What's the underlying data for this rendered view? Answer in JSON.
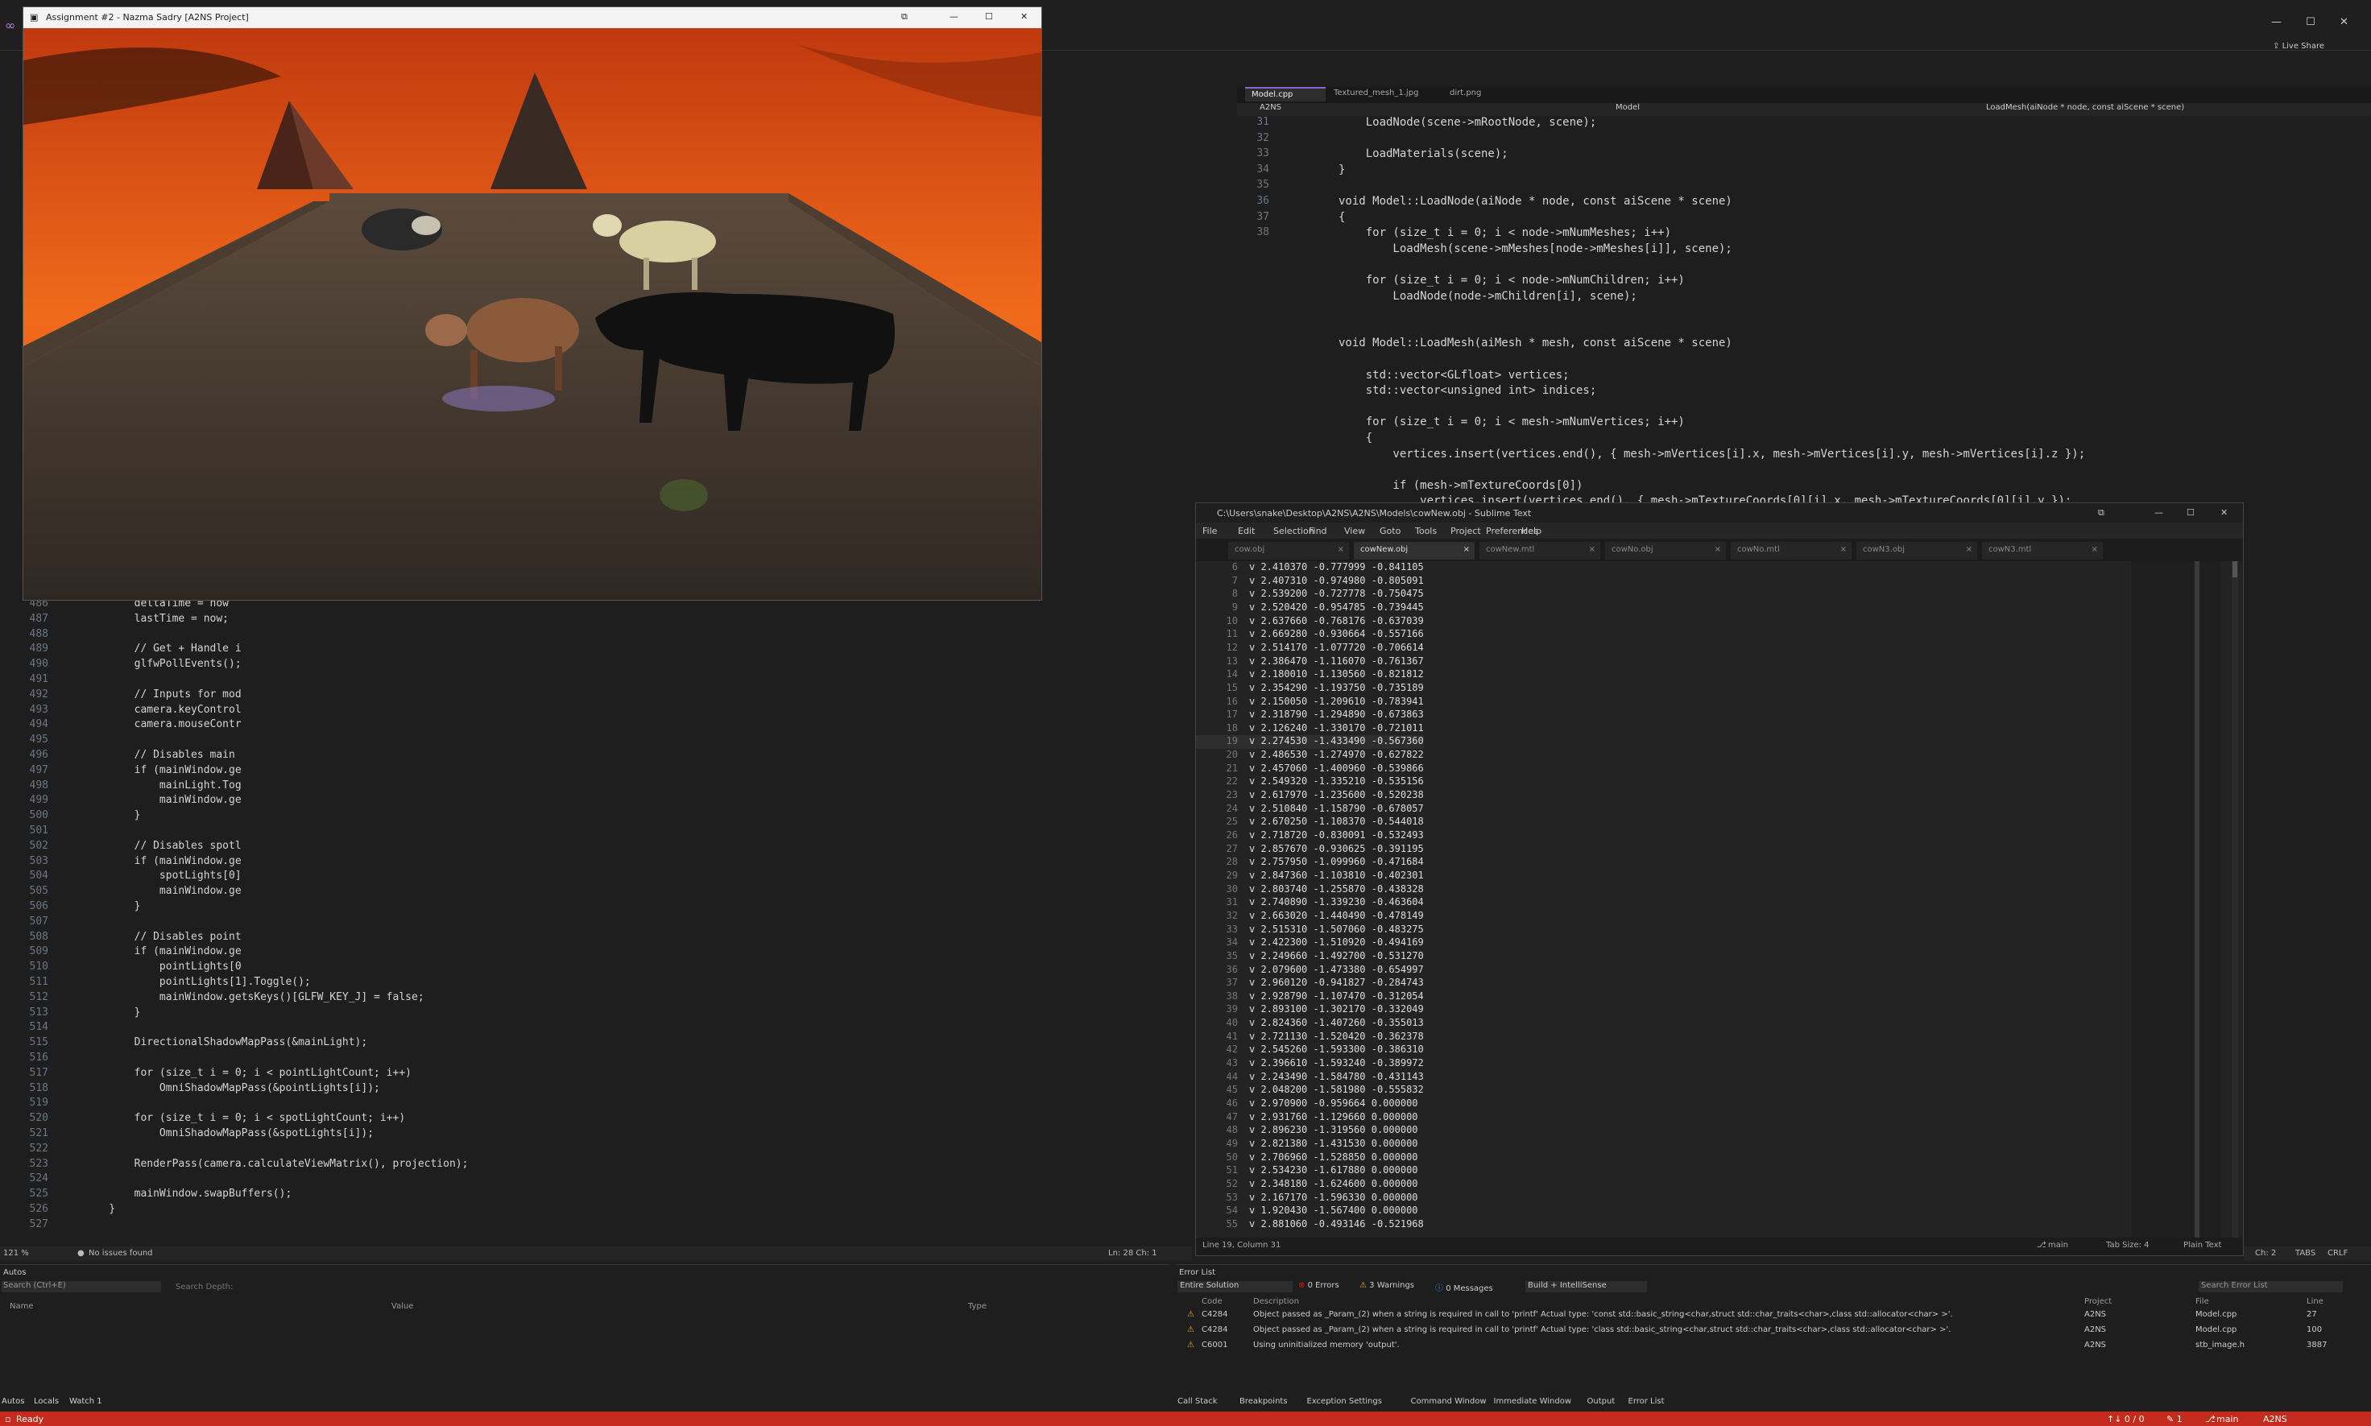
{
  "vs": {
    "live_share": "Live Share",
    "editor_tabs": [
      "Model.cpp",
      "Textured_mesh_1.jpg",
      "dirt.png"
    ],
    "nav_scope": "A2NS",
    "nav_class": "Model",
    "nav_method": "LoadMesh(aiNode * node, const aiScene * scene)",
    "code_lines": [
      {
        "n": "31",
        "t": "    LoadNode(scene->mRootNode, scene);"
      },
      {
        "n": "32",
        "t": ""
      },
      {
        "n": "33",
        "t": "    LoadMaterials(scene);"
      },
      {
        "n": "34",
        "t": "}"
      },
      {
        "n": "35",
        "t": ""
      },
      {
        "n": "36",
        "t": "void Model::LoadNode(aiNode * node, const aiScene * scene)"
      },
      {
        "n": "37",
        "t": "{"
      },
      {
        "n": "38",
        "t": "    for (size_t i = 0; i < node->mNumMeshes; i++)"
      },
      {
        "n": "",
        "t": "        LoadMesh(scene->mMeshes[node->mMeshes[i]], scene);"
      },
      {
        "n": "",
        "t": ""
      },
      {
        "n": "",
        "t": "    for (size_t i = 0; i < node->mNumChildren; i++)"
      },
      {
        "n": "",
        "t": "        LoadNode(node->mChildren[i], scene);"
      },
      {
        "n": "",
        "t": ""
      },
      {
        "n": "",
        "t": ""
      },
      {
        "n": "",
        "t": "void Model::LoadMesh(aiMesh * mesh, const aiScene * scene)"
      },
      {
        "n": "",
        "t": ""
      },
      {
        "n": "",
        "t": "    std::vector<GLfloat> vertices;"
      },
      {
        "n": "",
        "t": "    std::vector<unsigned int> indices;"
      },
      {
        "n": "",
        "t": ""
      },
      {
        "n": "",
        "t": "    for (size_t i = 0; i < mesh->mNumVertices; i++)"
      },
      {
        "n": "",
        "t": "    {"
      },
      {
        "n": "",
        "t": "        vertices.insert(vertices.end(), { mesh->mVertices[i].x, mesh->mVertices[i].y, mesh->mVertices[i].z });"
      },
      {
        "n": "",
        "t": ""
      },
      {
        "n": "",
        "t": "        if (mesh->mTextureCoords[0])"
      },
      {
        "n": "",
        "t": "            vertices.insert(vertices.end(), { mesh->mTextureCoords[0][i].x, mesh->mTextureCoords[0][i].y });"
      }
    ],
    "left_code": [
      {
        "n": "486",
        "t": "        deltaTime = now"
      },
      {
        "n": "487",
        "t": "        lastTime = now;"
      },
      {
        "n": "488",
        "t": ""
      },
      {
        "n": "489",
        "t": "        // Get + Handle i"
      },
      {
        "n": "490",
        "t": "        glfwPollEvents();"
      },
      {
        "n": "491",
        "t": ""
      },
      {
        "n": "492",
        "t": "        // Inputs for mod"
      },
      {
        "n": "493",
        "t": "        camera.keyControl"
      },
      {
        "n": "494",
        "t": "        camera.mouseContr"
      },
      {
        "n": "495",
        "t": ""
      },
      {
        "n": "496",
        "t": "        // Disables main"
      },
      {
        "n": "497",
        "t": "        if (mainWindow.ge"
      },
      {
        "n": "498",
        "t": "            mainLight.Tog"
      },
      {
        "n": "499",
        "t": "            mainWindow.ge"
      },
      {
        "n": "500",
        "t": "        }"
      },
      {
        "n": "501",
        "t": ""
      },
      {
        "n": "502",
        "t": "        // Disables spotl"
      },
      {
        "n": "503",
        "t": "        if (mainWindow.ge"
      },
      {
        "n": "504",
        "t": "            spotLights[0]"
      },
      {
        "n": "505",
        "t": "            mainWindow.ge"
      },
      {
        "n": "506",
        "t": "        }"
      },
      {
        "n": "507",
        "t": ""
      },
      {
        "n": "508",
        "t": "        // Disables point"
      },
      {
        "n": "509",
        "t": "        if (mainWindow.ge"
      },
      {
        "n": "510",
        "t": "            pointLights[0"
      },
      {
        "n": "511",
        "t": "            pointLights[1].Toggle();"
      },
      {
        "n": "512",
        "t": "            mainWindow.getsKeys()[GLFW_KEY_J] = false;"
      },
      {
        "n": "513",
        "t": "        }"
      },
      {
        "n": "514",
        "t": ""
      },
      {
        "n": "515",
        "t": "        DirectionalShadowMapPass(&mainLight);"
      },
      {
        "n": "516",
        "t": ""
      },
      {
        "n": "517",
        "t": "        for (size_t i = 0; i < pointLightCount; i++)"
      },
      {
        "n": "518",
        "t": "            OmniShadowMapPass(&pointLights[i]);"
      },
      {
        "n": "519",
        "t": ""
      },
      {
        "n": "520",
        "t": "        for (size_t i = 0; i < spotLightCount; i++)"
      },
      {
        "n": "521",
        "t": "            OmniShadowMapPass(&spotLights[i]);"
      },
      {
        "n": "522",
        "t": ""
      },
      {
        "n": "523",
        "t": "        RenderPass(camera.calculateViewMatrix(), projection);"
      },
      {
        "n": "524",
        "t": ""
      },
      {
        "n": "525",
        "t": "        mainWindow.swapBuffers();"
      },
      {
        "n": "526",
        "t": "    }"
      },
      {
        "n": "527",
        "t": ""
      }
    ],
    "left_status": {
      "zoom": "121 %",
      "issues": "No issues found",
      "pos": "Ln: 28   Ch: 1"
    },
    "right_status": {
      "pos": "Ch: 2",
      "tabs": "TABS",
      "crlf": "CRLF"
    }
  },
  "game": {
    "title": "Assignment #2 - Nazma Sadry [A2NS Project]"
  },
  "sublime": {
    "title": "C:\\Users\\snake\\Desktop\\A2NS\\A2NS\\Models\\cowNew.obj - Sublime Text",
    "menu": [
      "File",
      "Edit",
      "Selection",
      "Find",
      "View",
      "Goto",
      "Tools",
      "Project",
      "Preferences",
      "Help"
    ],
    "tabs": [
      "cow.obj",
      "cowNew.obj",
      "cowNew.mtl",
      "cowNo.obj",
      "cowNo.mtl",
      "cowN3.obj",
      "cowN3.mtl"
    ],
    "active_tab": 1,
    "lines": [
      {
        "n": "6",
        "t": "v 2.410370 -0.777999 -0.841105"
      },
      {
        "n": "7",
        "t": "v 2.407310 -0.974980 -0.805091"
      },
      {
        "n": "8",
        "t": "v 2.539200 -0.727778 -0.750475"
      },
      {
        "n": "9",
        "t": "v 2.520420 -0.954785 -0.739445"
      },
      {
        "n": "10",
        "t": "v 2.637660 -0.768176 -0.637039"
      },
      {
        "n": "11",
        "t": "v 2.669280 -0.930664 -0.557166"
      },
      {
        "n": "12",
        "t": "v 2.514170 -1.077720 -0.706614"
      },
      {
        "n": "13",
        "t": "v 2.386470 -1.116070 -0.761367"
      },
      {
        "n": "14",
        "t": "v 2.180010 -1.130560 -0.821812"
      },
      {
        "n": "15",
        "t": "v 2.354290 -1.193750 -0.735189"
      },
      {
        "n": "16",
        "t": "v 2.150050 -1.209610 -0.783941"
      },
      {
        "n": "17",
        "t": "v 2.318790 -1.294890 -0.673863"
      },
      {
        "n": "18",
        "t": "v 2.126240 -1.330170 -0.721011"
      },
      {
        "n": "19",
        "t": "v 2.274530 -1.433490 -0.567360"
      },
      {
        "n": "20",
        "t": "v 2.486530 -1.274970 -0.627822"
      },
      {
        "n": "21",
        "t": "v 2.457060 -1.400960 -0.539866"
      },
      {
        "n": "22",
        "t": "v 2.549320 -1.335210 -0.535156"
      },
      {
        "n": "23",
        "t": "v 2.617970 -1.235600 -0.520238"
      },
      {
        "n": "24",
        "t": "v 2.510840 -1.158790 -0.678057"
      },
      {
        "n": "25",
        "t": "v 2.670250 -1.108370 -0.544018"
      },
      {
        "n": "26",
        "t": "v 2.718720 -0.830091 -0.532493"
      },
      {
        "n": "27",
        "t": "v 2.857670 -0.930625 -0.391195"
      },
      {
        "n": "28",
        "t": "v 2.757950 -1.099960 -0.471684"
      },
      {
        "n": "29",
        "t": "v 2.847360 -1.103810 -0.402301"
      },
      {
        "n": "30",
        "t": "v 2.803740 -1.255870 -0.438328"
      },
      {
        "n": "31",
        "t": "v 2.740890 -1.339230 -0.463604"
      },
      {
        "n": "32",
        "t": "v 2.663020 -1.440490 -0.478149"
      },
      {
        "n": "33",
        "t": "v 2.515310 -1.507060 -0.483275"
      },
      {
        "n": "34",
        "t": "v 2.422300 -1.510920 -0.494169"
      },
      {
        "n": "35",
        "t": "v 2.249660 -1.492700 -0.531270"
      },
      {
        "n": "36",
        "t": "v 2.079600 -1.473380 -0.654997"
      },
      {
        "n": "37",
        "t": "v 2.960120 -0.941827 -0.284743"
      },
      {
        "n": "38",
        "t": "v 2.928790 -1.107470 -0.312054"
      },
      {
        "n": "39",
        "t": "v 2.893100 -1.302170 -0.332049"
      },
      {
        "n": "40",
        "t": "v 2.824360 -1.407260 -0.355013"
      },
      {
        "n": "41",
        "t": "v 2.721130 -1.520420 -0.362378"
      },
      {
        "n": "42",
        "t": "v 2.545260 -1.593300 -0.386310"
      },
      {
        "n": "43",
        "t": "v 2.396610 -1.593240 -0.389972"
      },
      {
        "n": "44",
        "t": "v 2.243490 -1.584780 -0.431143"
      },
      {
        "n": "45",
        "t": "v 2.048200 -1.581980 -0.555832"
      },
      {
        "n": "46",
        "t": "v 2.970900 -0.959664 0.000000"
      },
      {
        "n": "47",
        "t": "v 2.931760 -1.129660 0.000000"
      },
      {
        "n": "48",
        "t": "v 2.896230 -1.319560 0.000000"
      },
      {
        "n": "49",
        "t": "v 2.821380 -1.431530 0.000000"
      },
      {
        "n": "50",
        "t": "v 2.706960 -1.528850 0.000000"
      },
      {
        "n": "51",
        "t": "v 2.534230 -1.617880 0.000000"
      },
      {
        "n": "52",
        "t": "v 2.348180 -1.624600 0.000000"
      },
      {
        "n": "53",
        "t": "v 2.167170 -1.596330 0.000000"
      },
      {
        "n": "54",
        "t": "v 1.920430 -1.567400 0.000000"
      },
      {
        "n": "55",
        "t": "v 2.881060 -0.493146 -0.521968"
      }
    ],
    "status_left": "Line 19, Column 31",
    "status_branch": "main",
    "status_tab": "Tab Size: 4",
    "status_syntax": "Plain Text"
  },
  "error_list": {
    "title": "Error List",
    "scope": "Entire Solution",
    "errors": "0 Errors",
    "warnings": "3 Warnings",
    "messages": "0 Messages",
    "build": "Build + IntelliSense",
    "search": "Search Error List",
    "columns": [
      "Code",
      "Description",
      "Project",
      "File",
      "Line"
    ],
    "rows": [
      {
        "code": "C4284",
        "desc": "Object passed as _Param_(2) when a string is required in call to 'printf' Actual type: 'const std::basic_string<char,struct std::char_traits<char>,class std::allocator<char> >'.",
        "project": "A2NS",
        "file": "Model.cpp",
        "line": "27"
      },
      {
        "code": "C4284",
        "desc": "Object passed as _Param_(2) when a string is required in call to 'printf' Actual type: 'class std::basic_string<char,struct std::char_traits<char>,class std::allocator<char> >'.",
        "project": "A2NS",
        "file": "Model.cpp",
        "line": "100"
      },
      {
        "code": "C6001",
        "desc": "Using uninitialized memory 'output'.",
        "project": "A2NS",
        "file": "stb_image.h",
        "line": "3887"
      }
    ],
    "bottom_tabs": [
      "Call Stack",
      "Breakpoints",
      "Exception Settings",
      "Command Window",
      "Immediate Window",
      "Output",
      "Error List"
    ]
  },
  "autos": {
    "title": "Autos",
    "search": "Search (Ctrl+E)",
    "depth": "Search Depth:",
    "columns": [
      "Name",
      "Value",
      "Type"
    ],
    "bottom_tabs": [
      "Autos",
      "Locals",
      "Watch 1"
    ]
  },
  "statusbar": {
    "left": "Ready",
    "right": [
      "↑↓ 0 / 0",
      "✎ 1",
      "main",
      "A2NS"
    ]
  },
  "colors": {
    "accent": "#8a63d2",
    "status": "#c42b1c",
    "sky": "#e0501a"
  }
}
